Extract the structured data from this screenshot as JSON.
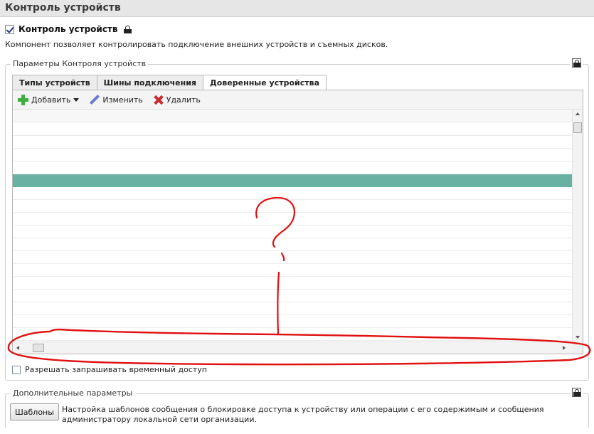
{
  "header": {
    "title": "Контроль устройств"
  },
  "main_toggle": {
    "label": "Контроль устройств",
    "checked": true
  },
  "description": "Компонент позволяет контролировать подключение внешних устройств и съемных дисков.",
  "params_group": {
    "legend": "Параметры Контроля устройств",
    "tabs": [
      {
        "label": "Типы устройств",
        "active": false
      },
      {
        "label": "Шины подключения",
        "active": false
      },
      {
        "label": "Доверенные устройства",
        "active": true
      }
    ],
    "toolbar": {
      "add_label": "Добавить",
      "edit_label": "Изменить",
      "delete_label": "Удалить"
    },
    "grid": {
      "row_count": 17,
      "selected_row_index": 4
    },
    "temp_access": {
      "label": "Разрешать запрашивать временный доступ",
      "checked": false
    }
  },
  "extra_group": {
    "legend": "Дополнительные параметры",
    "templates_button": "Шаблоны",
    "templates_text": "Настройка шаблонов сообщения о блокировке доступа к устройству или операции с его содержимым и сообщения администратору локальной сети организации."
  },
  "annotation": {
    "color": "#e01010"
  }
}
